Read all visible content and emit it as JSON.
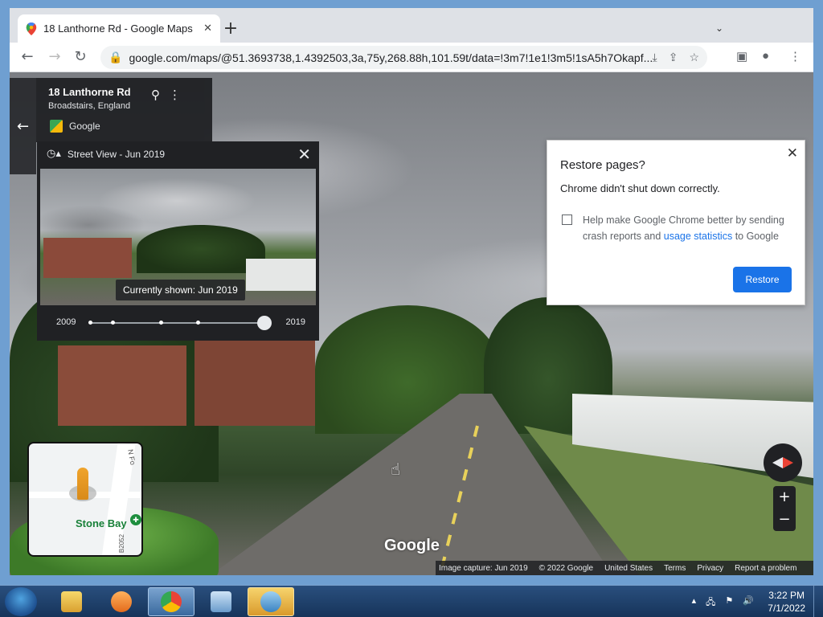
{
  "browser": {
    "tab_title": "18 Lanthorne Rd - Google Maps",
    "new_tab": "+",
    "url": "google.com/maps/@51.3693738,1.4392503,3a,75y,268.88h,101.59t/data=!3m7!1e1!3m5!1sA5h7Okapf..."
  },
  "address_card": {
    "title": "18 Lanthorne Rd",
    "subtitle": "Broadstairs, England",
    "source": "Google"
  },
  "time_panel": {
    "header": "Street View - Jun 2019",
    "tooltip": "Currently shown: Jun 2019",
    "start_year": "2009",
    "end_year": "2019",
    "timeline_dots": 4,
    "selected_position": 1.0
  },
  "restore_dialog": {
    "title": "Restore pages?",
    "subtitle": "Chrome didn't shut down correctly.",
    "checkbox_text_1": "Help make Google Chrome better by sending crash reports and ",
    "checkbox_link": "usage statistics",
    "checkbox_text_2": " to Google",
    "checkbox_checked": false,
    "button": "Restore"
  },
  "minimap": {
    "place_label": "Stone Bay",
    "road_label_1": "N Fo",
    "road_label_2": "B2052"
  },
  "watermark": "Google",
  "zoom": {
    "in": "+",
    "out": "−"
  },
  "footer": {
    "capture": "Image capture: Jun 2019",
    "copyright": "© 2022 Google",
    "region": "United States",
    "terms": "Terms",
    "privacy": "Privacy",
    "report": "Report a problem"
  },
  "taskbar": {
    "time": "3:22 PM",
    "date": "7/1/2022"
  },
  "colors": {
    "accent": "#1a73e8",
    "panel": "#202124",
    "taskbar": "#1f426d"
  }
}
